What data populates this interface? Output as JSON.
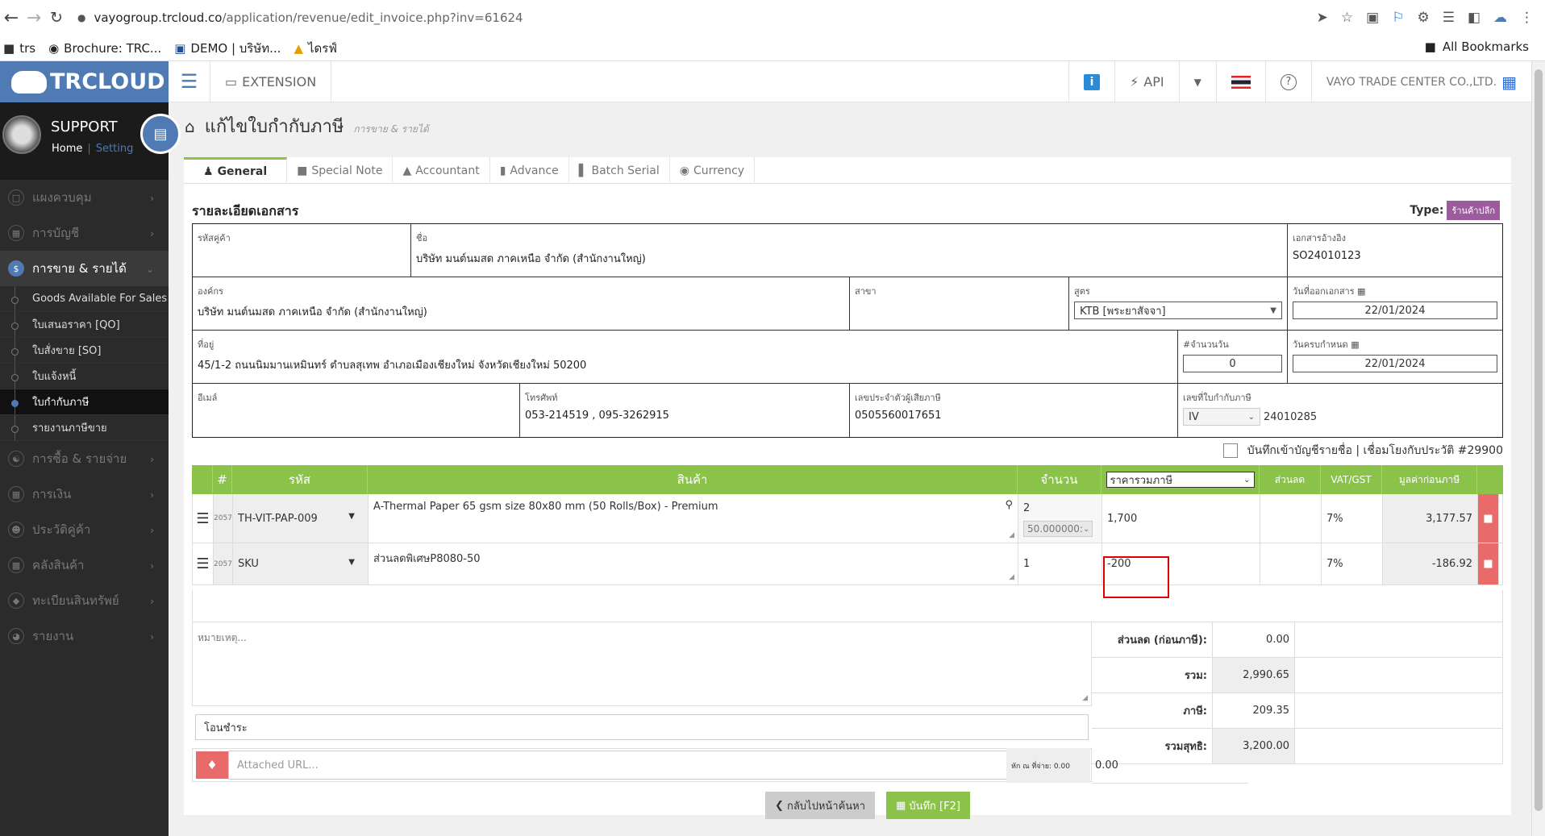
{
  "browser": {
    "url_host": "vayogroup.trcloud.co",
    "url_path": "/application/revenue/edit_invoice.php?inv=61624",
    "bookmarks": [
      "trs",
      "Brochure: TRC...",
      "DEMO | บริษัท...",
      "ไดรฟ์"
    ],
    "all_bookmarks": "All Bookmarks"
  },
  "sidebar": {
    "logo": "TRCLOUD",
    "user": "SUPPORT",
    "home_link": "Home",
    "setting_link": "Setting",
    "menu": [
      {
        "label": "แผงควบคุม",
        "icon": "monitor-icon"
      },
      {
        "label": "การบัญชี",
        "icon": "book-icon"
      },
      {
        "label": "การขาย & รายได้",
        "icon": "dollar-icon"
      }
    ],
    "submenu": [
      "Goods Available For Sales",
      "ใบเสนอราคา [QO]",
      "ใบสั่งขาย [SO]",
      "ใบแจ้งหนี้",
      "ใบกำกับภาษี",
      "รายงานภาษีขาย"
    ],
    "menu2": [
      {
        "label": "การซื้อ & รายจ่าย"
      },
      {
        "label": "การเงิน"
      },
      {
        "label": "ประวัติคู่ค้า"
      },
      {
        "label": "คลังสินค้า"
      },
      {
        "label": "ทะเบียนสินทรัพย์"
      },
      {
        "label": "รายงาน"
      }
    ]
  },
  "topnav": {
    "extension": "EXTENSION",
    "api": "API",
    "company": "VAYO TRADE CENTER CO.,LTD."
  },
  "page": {
    "title": "แก้ไขใบกำกับภาษี",
    "subtitle": "การขาย & รายได้",
    "tabs": [
      "General",
      "Special Note",
      "Accountant",
      "Advance",
      "Batch Serial",
      "Currency"
    ],
    "section_title": "รายละเอียดเอกสาร",
    "type_label": "Type:",
    "type_badge": "ร้านค้าปลีก"
  },
  "doc": {
    "customer_code_label": "รหัสคู่ค้า",
    "name_label": "ชื่อ",
    "name": "บริษัท มนต์นมสด ภาคเหนือ จำกัด (สำนักงานใหญ่)",
    "ref_label": "เอกสารอ้างอิง",
    "ref": "SO24010123",
    "org_label": "องค์กร",
    "org": "บริษัท มนต์นมสด ภาคเหนือ จำกัด (สำนักงานใหญ่)",
    "branch_label": "สาขา",
    "formula_label": "สูตร",
    "formula": "KTB [พระยาสัจจา]",
    "issue_date_label": "วันที่ออกเอกสาร",
    "issue_date": "22/01/2024",
    "address_label": "ที่อยู่",
    "address": "45/1-2 ถนนนิมมานเหมินทร์ ตำบลสุเทพ อำเภอเมืองเชียงใหม่ จังหวัดเชียงใหม่ 50200",
    "days_label": "#จำนวนวัน",
    "days": "0",
    "due_date_label": "วันครบกำหนด",
    "due_date": "22/01/2024",
    "email_label": "อีเมล์",
    "phone_label": "โทรศัพท์",
    "phone": "053-214519 , 095-3262915",
    "taxid_label": "เลขประจำตัวผู้เสียภาษี",
    "taxid": "0505560017651",
    "invoice_no_label": "เลขที่ใบกำกับภาษี",
    "invoice_prefix": "IV",
    "invoice_no": "24010285"
  },
  "account_link": "บันทึกเข้าบัญชีรายชื่อ | เชื่อมโยงกับประวัติ #29900",
  "items": {
    "headers": {
      "no": "#",
      "code": "รหัส",
      "product": "สินค้า",
      "qty": "จำนวน",
      "price_mode": "ราคารวมภาษี",
      "discount": "ส่วนลด",
      "vat": "VAT/GST",
      "amount": "มูลค่าก่อนภาษี"
    },
    "rows": [
      {
        "no": "2057",
        "code": "TH-VIT-PAP-009",
        "product": "A-Thermal Paper 65 gsm size 80x80 mm (50 Rolls/Box) - Premium",
        "qty": "2",
        "unit": "50.000000:",
        "price": "1,700",
        "vat": "7%",
        "amount": "3,177.57"
      },
      {
        "no": "2057",
        "code": "SKU",
        "product": "ส่วนลดพิเศษP8080-50",
        "qty": "1",
        "unit": "",
        "price": "-200",
        "vat": "7%",
        "amount": "-186.92"
      }
    ]
  },
  "footer": {
    "note_placeholder": "หมายเหตุ...",
    "payment": "โอนชำระ",
    "attach_placeholder": "Attached URL...",
    "wht_label": "หัก ณ ที่จ่าย: 0.00",
    "wht_value": "0.00",
    "discount_label": "ส่วนลด (ก่อนภาษี):",
    "discount_value": "0.00",
    "total_label": "รวม:",
    "total_value": "2,990.65",
    "tax_label": "ภาษี:",
    "tax_value": "209.35",
    "net_label": "รวมสุทธิ:",
    "net_value": "3,200.00",
    "back_button": "กลับไปหน้าค้นหา",
    "save_button": "บันทึก [F2]"
  },
  "colors": {
    "accent": "#4f7ab3",
    "green": "#8bc34a",
    "danger": "#e96a6a"
  }
}
